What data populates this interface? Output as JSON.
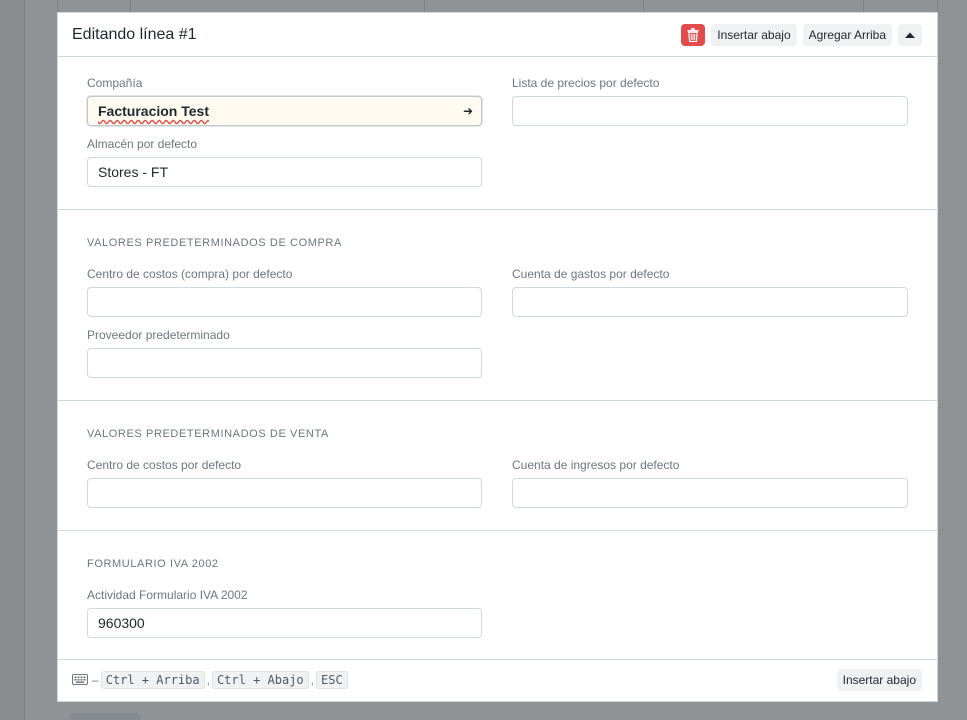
{
  "panel": {
    "title": "Editando línea #1",
    "insert_below": "Insertar abajo",
    "add_above": "Agregar Arriba"
  },
  "section_main": {
    "company_label": "Compañía",
    "company_value": "Facturacion Test",
    "price_list_label": "Lista de precios por defecto",
    "price_list_value": "",
    "warehouse_label": "Almacén por defecto",
    "warehouse_value": "Stores - FT"
  },
  "section_purchase": {
    "title": "VALORES PREDETERMINADOS DE COMPRA",
    "cost_center_label": "Centro de costos (compra) por defecto",
    "cost_center_value": "",
    "expense_account_label": "Cuenta de gastos por defecto",
    "expense_account_value": "",
    "supplier_label": "Proveedor predeterminado",
    "supplier_value": ""
  },
  "section_sales": {
    "title": "VALORES PREDETERMINADOS DE VENTA",
    "cost_center_label": "Centro de costos por defecto",
    "cost_center_value": "",
    "income_account_label": "Cuenta de ingresos por defecto",
    "income_account_value": ""
  },
  "section_iva": {
    "title": "FORMULARIO IVA 2002",
    "activity_label": "Actividad Formulario IVA 2002",
    "activity_value": "960300"
  },
  "footer": {
    "dash": "–",
    "key_up": "Ctrl + Arriba",
    "comma1": ",",
    "key_down": "Ctrl + Abajo",
    "comma2": ",",
    "key_esc": "ESC",
    "insert_below": "Insertar abajo"
  },
  "colors": {
    "delete": "#e24c4c",
    "active_field_bg": "#fffbf0"
  }
}
